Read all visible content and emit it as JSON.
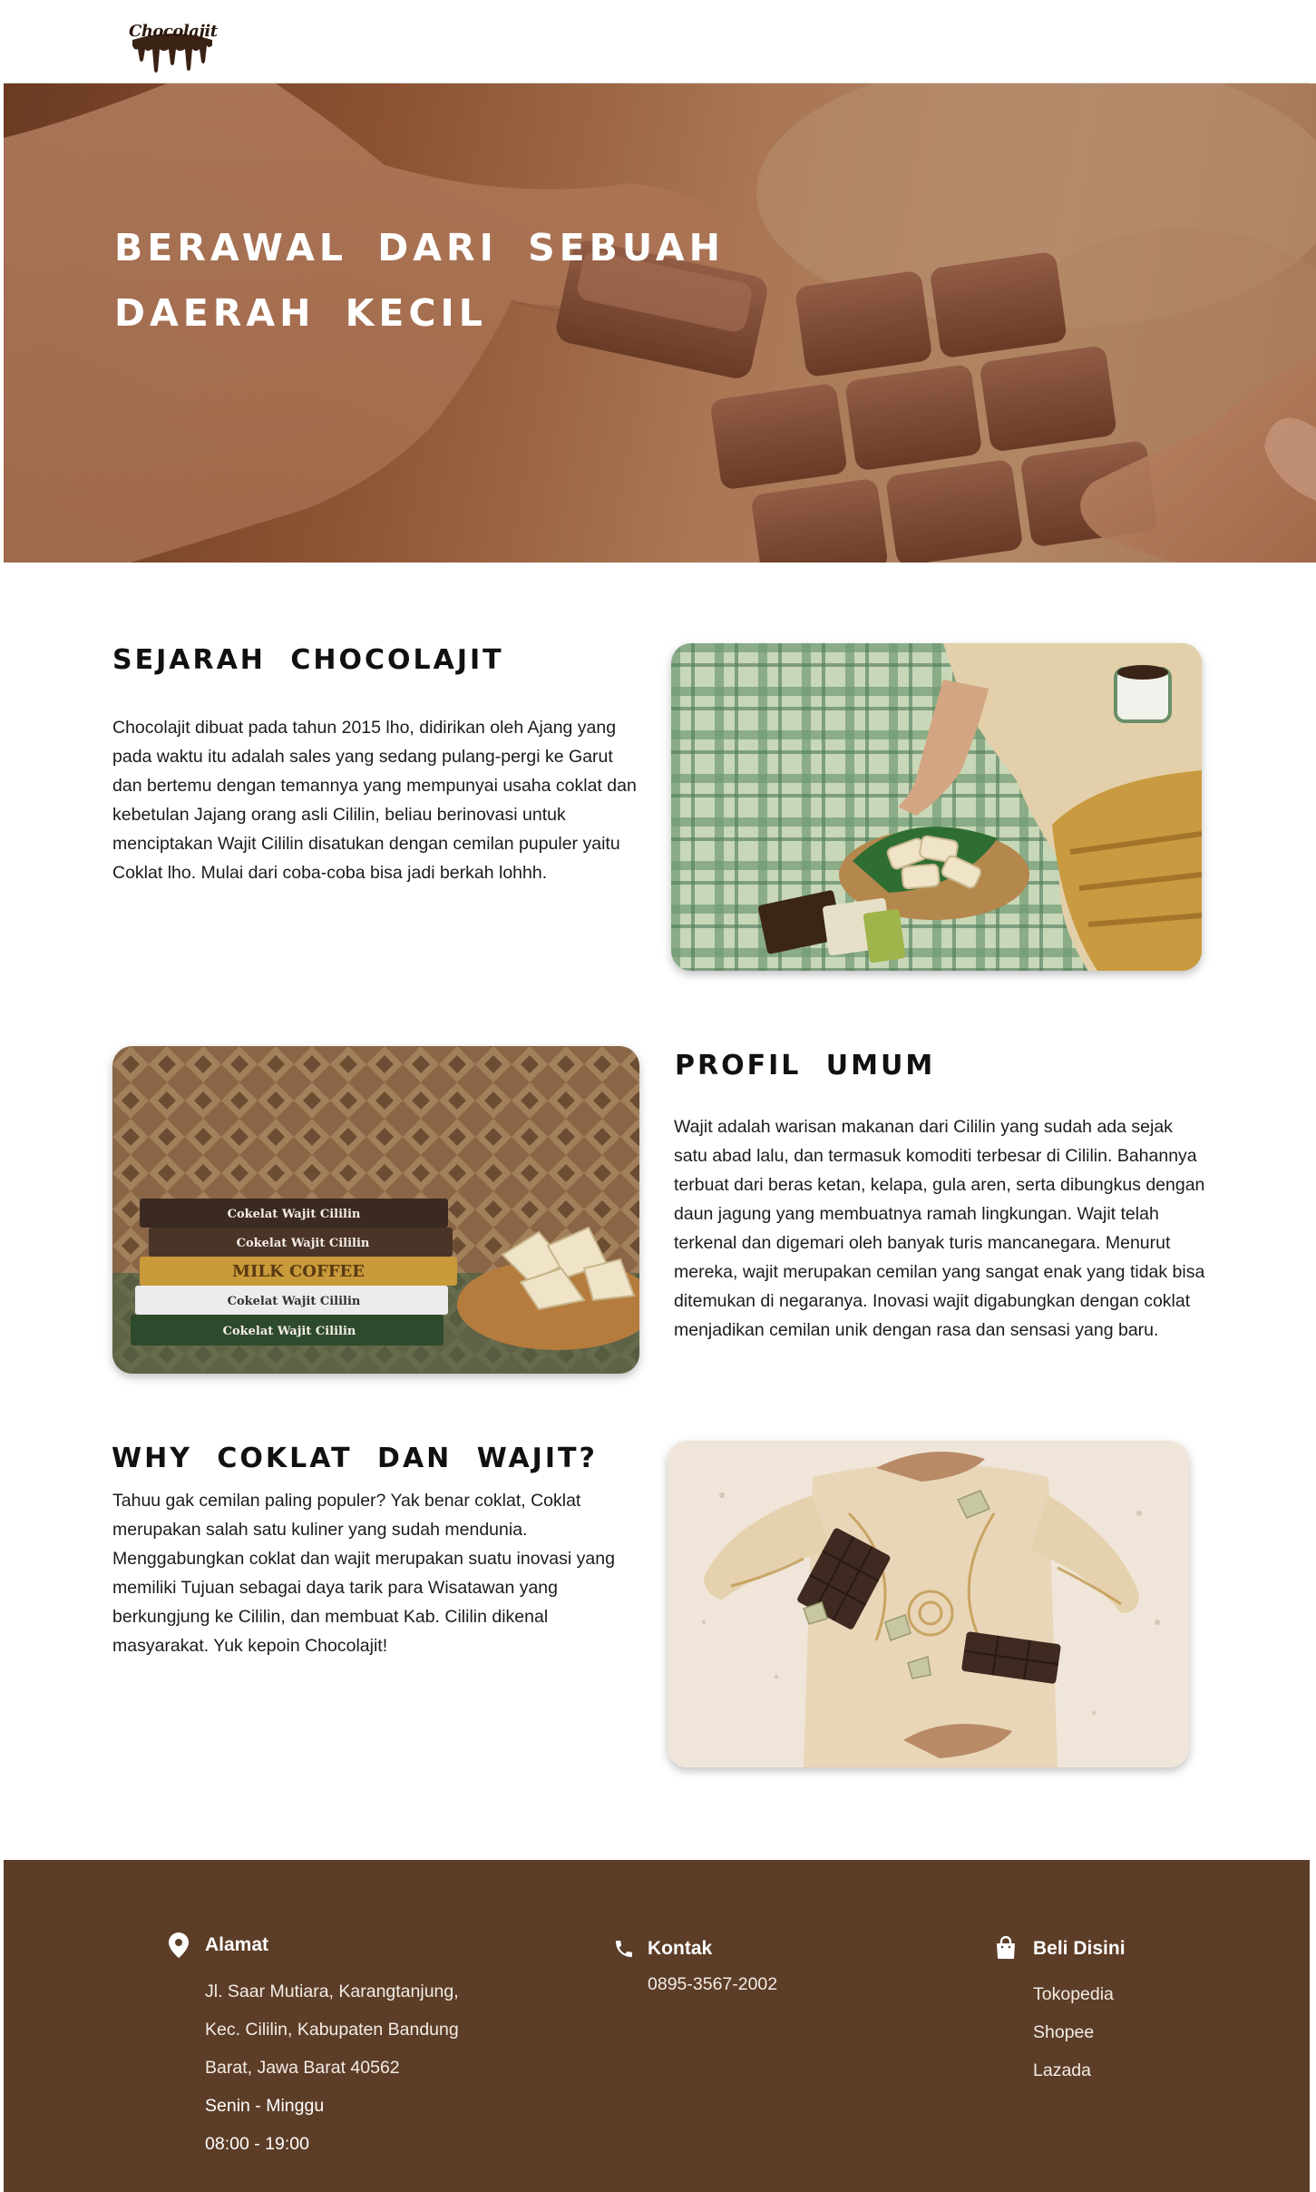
{
  "header": {
    "logo_text": "Chocolajit"
  },
  "hero": {
    "title": "BERAWAL DARI SEBUAH DAERAH KECIL"
  },
  "sejarah": {
    "title": "SEJARAH CHOCOLAJIT",
    "text": "Chocolajit dibuat pada tahun 2015 lho, didirikan oleh Ajang yang pada waktu itu adalah sales yang sedang pulang-pergi ke Garut dan bertemu dengan temannya yang mempunyai usaha coklat dan kebetulan Jajang orang asli Cililin, beliau berinovasi untuk menciptakan Wajit Cililin disatukan dengan cemilan pupuler yaitu Coklat lho. Mulai dari coba-coba bisa jadi berkah lohhh."
  },
  "profil": {
    "title": "PROFIL UMUM",
    "text": "Wajit adalah warisan makanan dari Cililin  yang sudah ada sejak satu abad lalu, dan termasuk komoditi terbesar di Cililin. Bahannya terbuat dari beras ketan, kelapa, gula aren, serta dibungkus dengan daun jagung yang membuatnya ramah lingkungan. Wajit telah terkenal dan digemari oleh banyak turis mancanegara. Menurut mereka, wajit merupakan cemilan yang sangat enak yang tidak bisa ditemukan di negaranya. Inovasi wajit digabungkan dengan coklat menjadikan cemilan unik dengan rasa dan sensasi yang baru.",
    "package_labels": [
      "Cokelat Wajit Cililin",
      "Cokelat Wajit Cililin",
      "MILK COFFEE",
      "Cokelat Wajit Cililin",
      "Cokelat Wajit Cililin"
    ]
  },
  "why": {
    "title": "WHY COKLAT DAN WAJIT?",
    "text": "Tahuu gak cemilan paling populer? Yak benar coklat, Coklat merupakan salah satu kuliner yang sudah mendunia. Menggabungkan coklat dan wajit merupakan suatu inovasi yang memiliki Tujuan sebagai daya tarik para Wisatawan yang berkungjung ke Cililin, dan membuat Kab. Cililin dikenal masyarakat. Yuk kepoin Chocolajit!"
  },
  "footer": {
    "alamat": {
      "heading": "Alamat",
      "lines": [
        "Jl. Saar Mutiara, Karangtanjung,",
        "Kec. Cililin, Kabupaten Bandung",
        "Barat, Jawa Barat 40562",
        "Senin - Minggu",
        "08:00 - 19:00"
      ]
    },
    "kontak": {
      "heading": "Kontak",
      "phone": "0895-3567-2002"
    },
    "beli": {
      "heading": "Beli Disini",
      "links": [
        "Tokopedia",
        "Shopee",
        "Lazada"
      ]
    }
  },
  "icons": {
    "alamat": "map-pin-icon",
    "kontak": "phone-icon",
    "beli": "shopping-bag-icon"
  },
  "colors": {
    "footer_bg": "#5c3d27",
    "hero_overlay": "#7a4a2e",
    "text_dark": "#111111"
  }
}
